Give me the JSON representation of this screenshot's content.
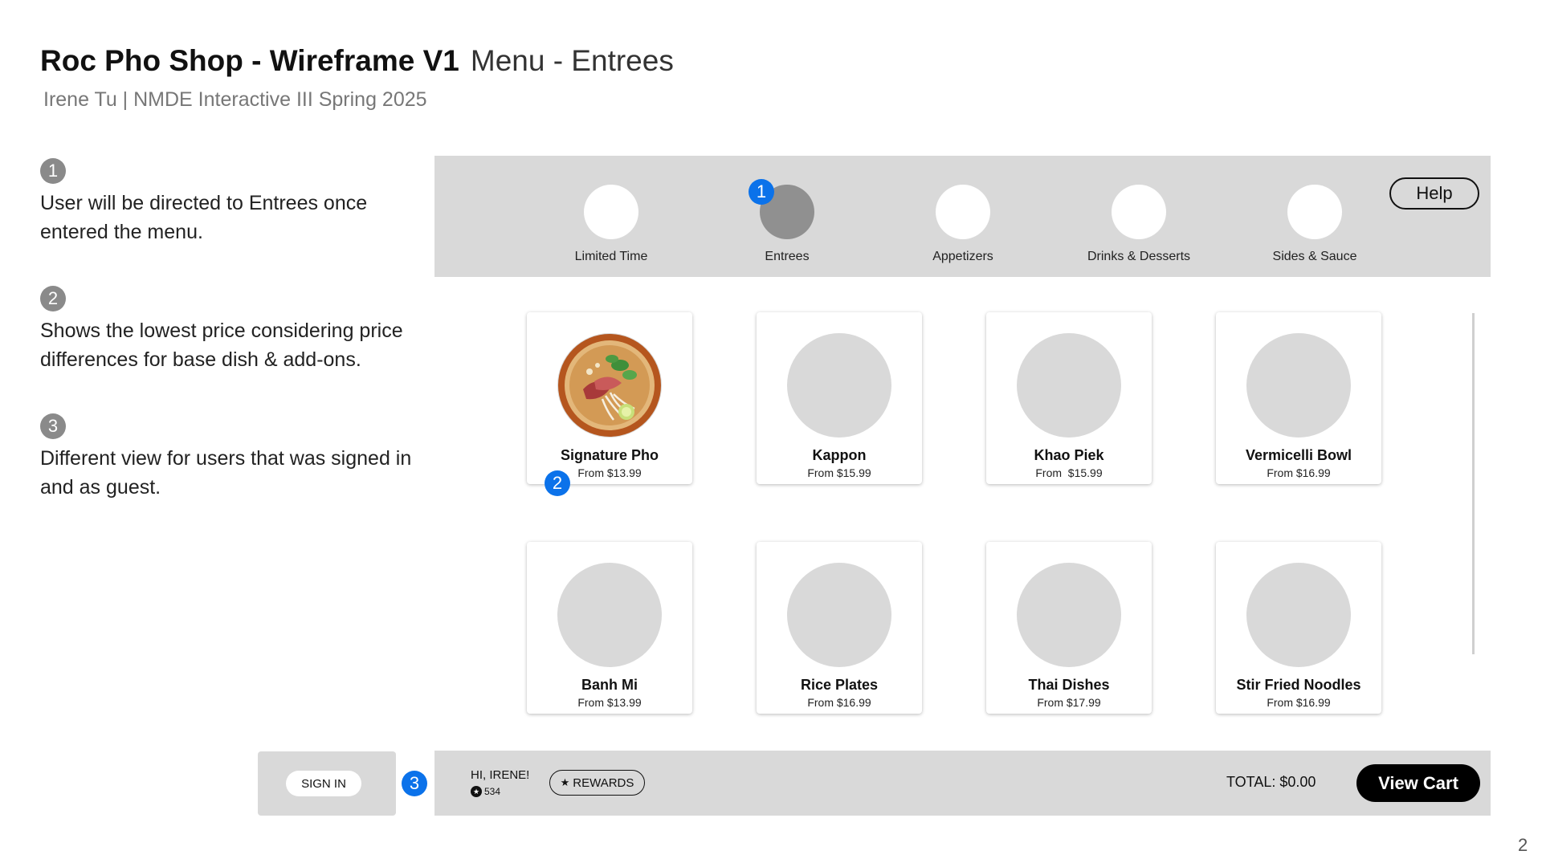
{
  "header": {
    "title": "Roc Pho Shop - Wireframe V1",
    "subtitle": "Menu - Entrees",
    "byline": "Irene Tu | NMDE Interactive III Spring 2025"
  },
  "notes": [
    {
      "number": "1",
      "text": "User will be directed to Entrees once entered the menu."
    },
    {
      "number": "2",
      "text": "Shows the lowest price considering price differences for base dish & add-ons."
    },
    {
      "number": "3",
      "text": "Different view for users that was signed in and as guest."
    }
  ],
  "categories": [
    {
      "label": "Limited Time"
    },
    {
      "label": "Entrees"
    },
    {
      "label": "Appetizers"
    },
    {
      "label": "Drinks & Desserts"
    },
    {
      "label": "Sides & Sauce"
    }
  ],
  "help_label": "Help",
  "markers": {
    "m1": "1",
    "m2": "2",
    "m3": "3"
  },
  "menu_items": [
    {
      "name": "Signature Pho",
      "price": "From $13.99"
    },
    {
      "name": "Kappon",
      "price": "From $15.99"
    },
    {
      "name": "Khao Piek",
      "price": "From  $15.99"
    },
    {
      "name": "Vermicelli Bowl",
      "price": "From $16.99"
    },
    {
      "name": "Banh Mi",
      "price": "From $13.99"
    },
    {
      "name": "Rice Plates",
      "price": "From $16.99"
    },
    {
      "name": "Thai Dishes",
      "price": "From $17.99"
    },
    {
      "name": "Stir Fried Noodles",
      "price": "From $16.99"
    }
  ],
  "signin_label": "SIGN IN",
  "bottom_bar": {
    "greeting": "HI, IRENE!",
    "points": "534",
    "rewards_label": "REWARDS",
    "total": "TOTAL: $0.00",
    "cart_label": "View Cart"
  },
  "page_number": "2",
  "colors": {
    "accent_blue": "#0b72ea",
    "panel_gray": "#d9d9d9",
    "placeholder_gray": "#d9d9d9",
    "active_category": "#909090"
  }
}
